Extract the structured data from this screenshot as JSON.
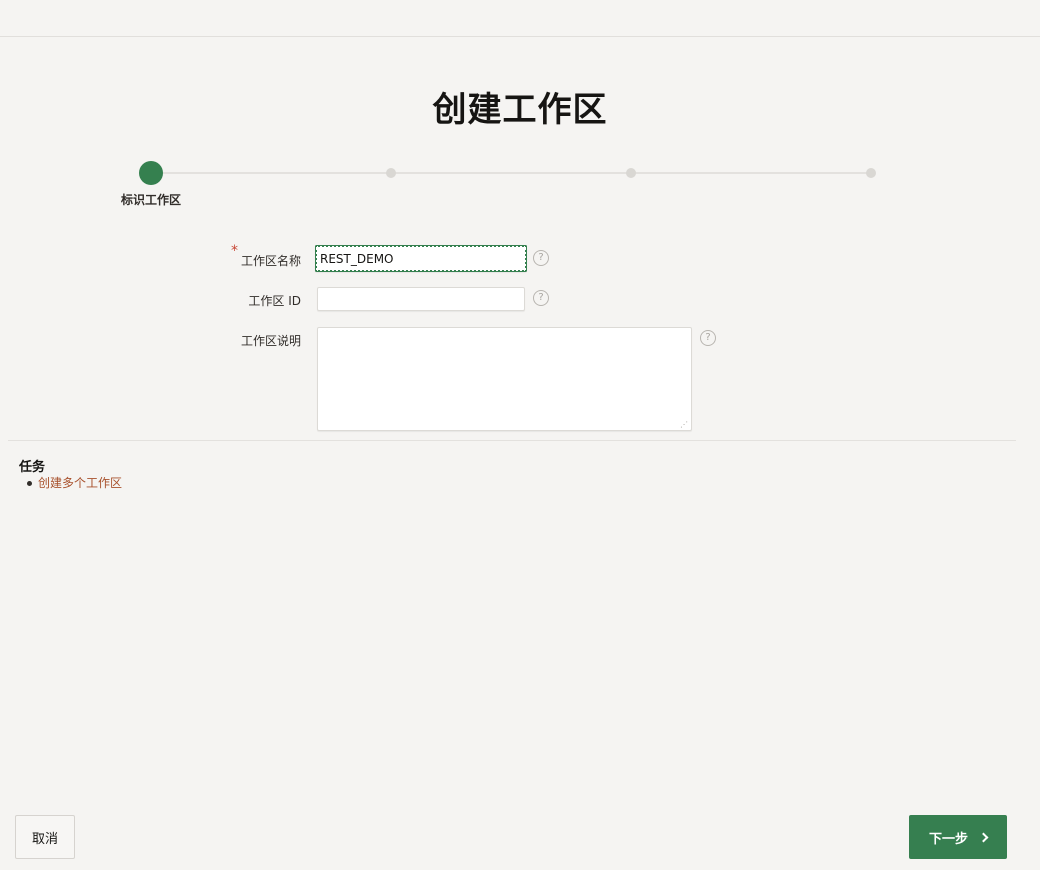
{
  "page": {
    "title": "创建工作区"
  },
  "wizard": {
    "steps": [
      {
        "label": "标识工作区",
        "state": "current"
      },
      {
        "label": "",
        "state": "pending"
      },
      {
        "label": "",
        "state": "pending"
      },
      {
        "label": "",
        "state": "pending"
      }
    ]
  },
  "form": {
    "workspace_name": {
      "label": "工作区名称",
      "value": "REST_DEMO",
      "required_marker": "*"
    },
    "workspace_id": {
      "label": "工作区 ID",
      "value": ""
    },
    "workspace_description": {
      "label": "工作区说明",
      "value": ""
    },
    "help_glyph": "?"
  },
  "tasks": {
    "heading": "任务",
    "items": [
      {
        "label": "创建多个工作区"
      }
    ]
  },
  "footer": {
    "cancel_label": "取消",
    "next_label": "下一步"
  },
  "colors": {
    "accent": "#35804f",
    "link": "#a8512c",
    "required": "#c74634"
  }
}
